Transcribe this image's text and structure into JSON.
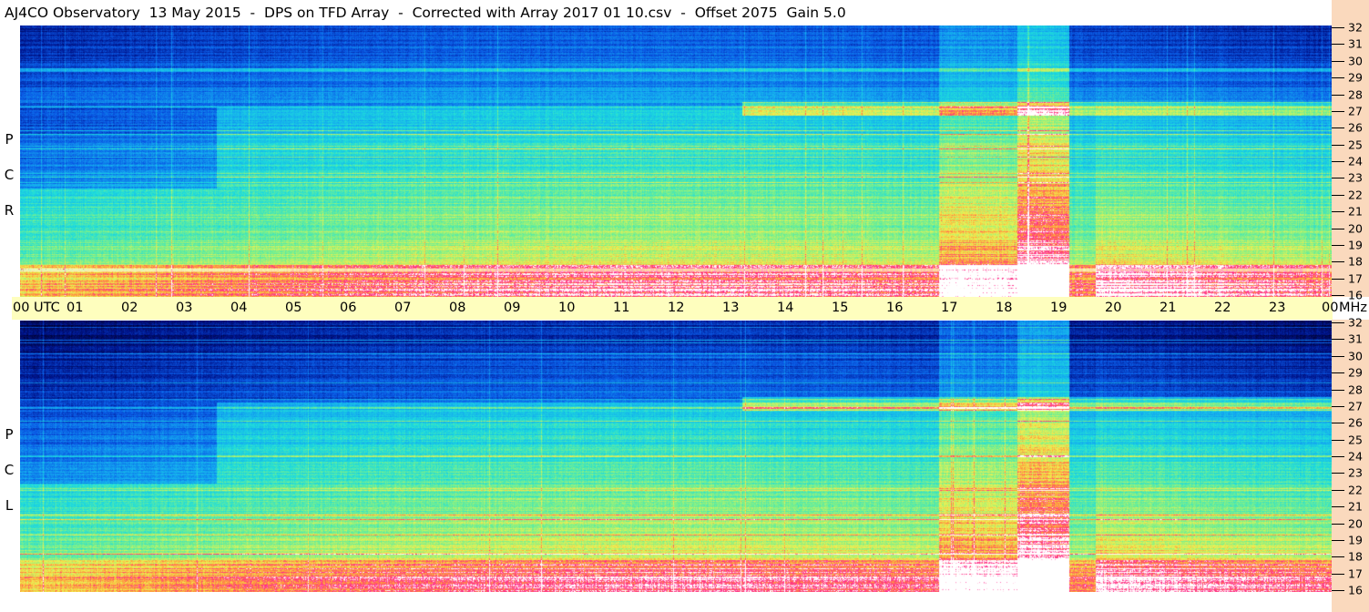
{
  "window": {
    "title": "AJ4CO Observatory  13 May 2015  -  DPS on TFD Array  -  Corrected with Array 2017 01 10.csv  -  Offset 2075  Gain 5.0"
  },
  "chart_data": [
    {
      "type": "heatmap",
      "title": "",
      "panel_label": [
        "R",
        "C",
        "P"
      ],
      "x": [
        "00",
        "01",
        "02",
        "03",
        "04",
        "05",
        "06",
        "07",
        "08",
        "09",
        "10",
        "11",
        "12",
        "13",
        "14",
        "15",
        "16",
        "17",
        "18",
        "19",
        "20",
        "21",
        "22",
        "23",
        "00"
      ],
      "xlabel": "UTC",
      "xlim": [
        0,
        24
      ],
      "y": [
        16,
        17,
        18,
        19,
        20,
        21,
        22,
        23,
        24,
        25,
        26,
        27,
        28,
        29,
        30,
        31,
        32
      ],
      "ylabel": "MHz",
      "ylim": [
        16,
        32
      ]
    },
    {
      "type": "heatmap",
      "title": "",
      "panel_label": [
        "L",
        "C",
        "P"
      ],
      "x": [
        "00",
        "01",
        "02",
        "03",
        "04",
        "05",
        "06",
        "07",
        "08",
        "09",
        "10",
        "11",
        "12",
        "13",
        "14",
        "15",
        "16",
        "17",
        "18",
        "19",
        "20",
        "21",
        "22",
        "23",
        "00"
      ],
      "xlabel": "UTC",
      "xlim": [
        0,
        24
      ],
      "y": [
        16,
        17,
        18,
        19,
        20,
        21,
        22,
        23,
        24,
        25,
        26,
        27,
        28,
        29,
        30,
        31,
        32
      ],
      "ylabel": "MHz",
      "ylim": [
        16,
        32
      ]
    }
  ]
}
